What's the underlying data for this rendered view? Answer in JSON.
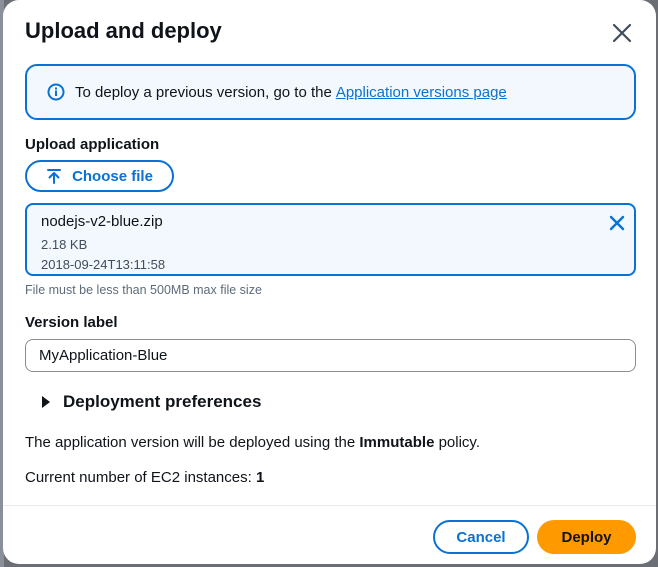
{
  "dialog": {
    "title": "Upload and deploy"
  },
  "alert": {
    "text": "To deploy a previous version, go to the",
    "link_label": "Application versions page"
  },
  "upload": {
    "label": "Upload application",
    "button_label": "Choose file",
    "file": {
      "name": "nodejs-v2-blue.zip",
      "size": "2.18 KB",
      "modified": "2018-09-24T13:11:58"
    },
    "constraint": "File must be less than 500MB max file size"
  },
  "version": {
    "label": "Version label",
    "value": "MyApplication-Blue"
  },
  "preferences": {
    "label": "Deployment preferences"
  },
  "policy": {
    "prefix": "The application version will be deployed using the",
    "name": "Immutable",
    "suffix": "policy."
  },
  "instances": {
    "label": "Current number of EC2 instances:",
    "count": "1"
  },
  "footer": {
    "cancel_label": "Cancel",
    "deploy_label": "Deploy"
  },
  "colors": {
    "primary": "#0972d3",
    "deploy": "#ff9900",
    "alert_bg": "#f2f8fd"
  },
  "icons": {
    "close": "close-icon",
    "info": "info-icon",
    "upload": "upload-icon",
    "dismiss": "dismiss-icon",
    "caret": "caret-right-icon"
  }
}
